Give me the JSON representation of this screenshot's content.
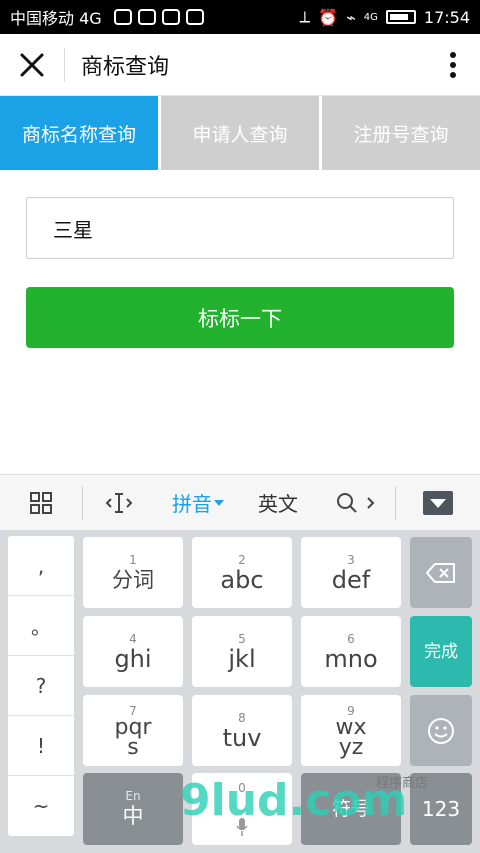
{
  "status": {
    "carrier": "中国移动 4G",
    "time": "17:54",
    "net_badge": "4G"
  },
  "nav": {
    "title": "商标查询"
  },
  "tabs": [
    {
      "label": "商标名称查询",
      "active": true
    },
    {
      "label": "申请人查询",
      "active": false
    },
    {
      "label": "注册号查询",
      "active": false
    }
  ],
  "search": {
    "value": "三星"
  },
  "submit": {
    "label": "标标一下"
  },
  "ime": {
    "pinyin_label": "拼音",
    "english_label": "英文"
  },
  "keyboard": {
    "punct": [
      ",",
      "。",
      "?",
      "!",
      "~"
    ],
    "keys": [
      {
        "num": "1",
        "label": "分词"
      },
      {
        "num": "2",
        "label": "abc"
      },
      {
        "num": "3",
        "label": "def"
      },
      {
        "num": "4",
        "label": "ghi"
      },
      {
        "num": "5",
        "label": "jkl"
      },
      {
        "num": "6",
        "label": "mno"
      },
      {
        "num": "7",
        "label": "pqrs"
      },
      {
        "num": "8",
        "label": "tuv"
      },
      {
        "num": "9",
        "label": "wxyz"
      }
    ],
    "done_label": "完成",
    "lang_sub": "En",
    "lang_main": "中",
    "zero_num": "0",
    "symbol_label": "符号",
    "num_label": "123"
  },
  "watermark": {
    "text": "9lud.com",
    "subtext": "程序商店"
  },
  "colors": {
    "tab_active": "#1aa1e6",
    "tab_inactive": "#cfcfcf",
    "button": "#22b22e",
    "done_key": "#2cb9ae"
  }
}
